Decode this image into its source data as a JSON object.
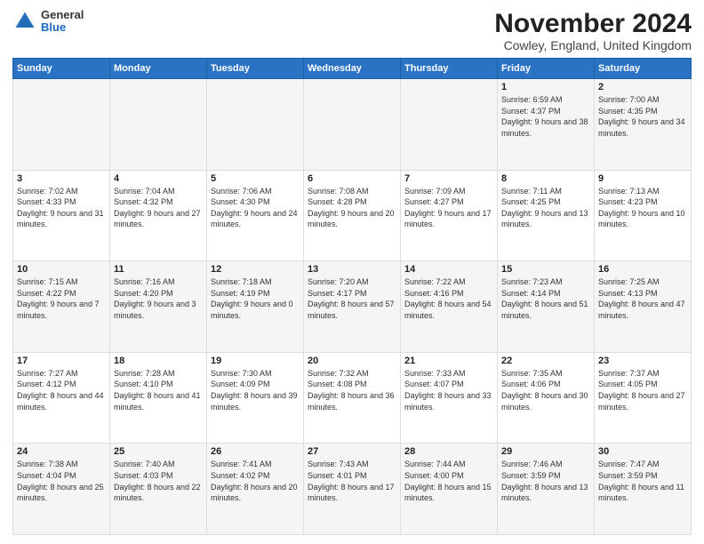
{
  "header": {
    "logo_general": "General",
    "logo_blue": "Blue",
    "month_title": "November 2024",
    "location": "Cowley, England, United Kingdom"
  },
  "columns": [
    "Sunday",
    "Monday",
    "Tuesday",
    "Wednesday",
    "Thursday",
    "Friday",
    "Saturday"
  ],
  "weeks": [
    [
      {
        "day": "",
        "info": ""
      },
      {
        "day": "",
        "info": ""
      },
      {
        "day": "",
        "info": ""
      },
      {
        "day": "",
        "info": ""
      },
      {
        "day": "",
        "info": ""
      },
      {
        "day": "1",
        "info": "Sunrise: 6:59 AM\nSunset: 4:37 PM\nDaylight: 9 hours and 38 minutes."
      },
      {
        "day": "2",
        "info": "Sunrise: 7:00 AM\nSunset: 4:35 PM\nDaylight: 9 hours and 34 minutes."
      }
    ],
    [
      {
        "day": "3",
        "info": "Sunrise: 7:02 AM\nSunset: 4:33 PM\nDaylight: 9 hours and 31 minutes."
      },
      {
        "day": "4",
        "info": "Sunrise: 7:04 AM\nSunset: 4:32 PM\nDaylight: 9 hours and 27 minutes."
      },
      {
        "day": "5",
        "info": "Sunrise: 7:06 AM\nSunset: 4:30 PM\nDaylight: 9 hours and 24 minutes."
      },
      {
        "day": "6",
        "info": "Sunrise: 7:08 AM\nSunset: 4:28 PM\nDaylight: 9 hours and 20 minutes."
      },
      {
        "day": "7",
        "info": "Sunrise: 7:09 AM\nSunset: 4:27 PM\nDaylight: 9 hours and 17 minutes."
      },
      {
        "day": "8",
        "info": "Sunrise: 7:11 AM\nSunset: 4:25 PM\nDaylight: 9 hours and 13 minutes."
      },
      {
        "day": "9",
        "info": "Sunrise: 7:13 AM\nSunset: 4:23 PM\nDaylight: 9 hours and 10 minutes."
      }
    ],
    [
      {
        "day": "10",
        "info": "Sunrise: 7:15 AM\nSunset: 4:22 PM\nDaylight: 9 hours and 7 minutes."
      },
      {
        "day": "11",
        "info": "Sunrise: 7:16 AM\nSunset: 4:20 PM\nDaylight: 9 hours and 3 minutes."
      },
      {
        "day": "12",
        "info": "Sunrise: 7:18 AM\nSunset: 4:19 PM\nDaylight: 9 hours and 0 minutes."
      },
      {
        "day": "13",
        "info": "Sunrise: 7:20 AM\nSunset: 4:17 PM\nDaylight: 8 hours and 57 minutes."
      },
      {
        "day": "14",
        "info": "Sunrise: 7:22 AM\nSunset: 4:16 PM\nDaylight: 8 hours and 54 minutes."
      },
      {
        "day": "15",
        "info": "Sunrise: 7:23 AM\nSunset: 4:14 PM\nDaylight: 8 hours and 51 minutes."
      },
      {
        "day": "16",
        "info": "Sunrise: 7:25 AM\nSunset: 4:13 PM\nDaylight: 8 hours and 47 minutes."
      }
    ],
    [
      {
        "day": "17",
        "info": "Sunrise: 7:27 AM\nSunset: 4:12 PM\nDaylight: 8 hours and 44 minutes."
      },
      {
        "day": "18",
        "info": "Sunrise: 7:28 AM\nSunset: 4:10 PM\nDaylight: 8 hours and 41 minutes."
      },
      {
        "day": "19",
        "info": "Sunrise: 7:30 AM\nSunset: 4:09 PM\nDaylight: 8 hours and 39 minutes."
      },
      {
        "day": "20",
        "info": "Sunrise: 7:32 AM\nSunset: 4:08 PM\nDaylight: 8 hours and 36 minutes."
      },
      {
        "day": "21",
        "info": "Sunrise: 7:33 AM\nSunset: 4:07 PM\nDaylight: 8 hours and 33 minutes."
      },
      {
        "day": "22",
        "info": "Sunrise: 7:35 AM\nSunset: 4:06 PM\nDaylight: 8 hours and 30 minutes."
      },
      {
        "day": "23",
        "info": "Sunrise: 7:37 AM\nSunset: 4:05 PM\nDaylight: 8 hours and 27 minutes."
      }
    ],
    [
      {
        "day": "24",
        "info": "Sunrise: 7:38 AM\nSunset: 4:04 PM\nDaylight: 8 hours and 25 minutes."
      },
      {
        "day": "25",
        "info": "Sunrise: 7:40 AM\nSunset: 4:03 PM\nDaylight: 8 hours and 22 minutes."
      },
      {
        "day": "26",
        "info": "Sunrise: 7:41 AM\nSunset: 4:02 PM\nDaylight: 8 hours and 20 minutes."
      },
      {
        "day": "27",
        "info": "Sunrise: 7:43 AM\nSunset: 4:01 PM\nDaylight: 8 hours and 17 minutes."
      },
      {
        "day": "28",
        "info": "Sunrise: 7:44 AM\nSunset: 4:00 PM\nDaylight: 8 hours and 15 minutes."
      },
      {
        "day": "29",
        "info": "Sunrise: 7:46 AM\nSunset: 3:59 PM\nDaylight: 8 hours and 13 minutes."
      },
      {
        "day": "30",
        "info": "Sunrise: 7:47 AM\nSunset: 3:59 PM\nDaylight: 8 hours and 11 minutes."
      }
    ]
  ]
}
